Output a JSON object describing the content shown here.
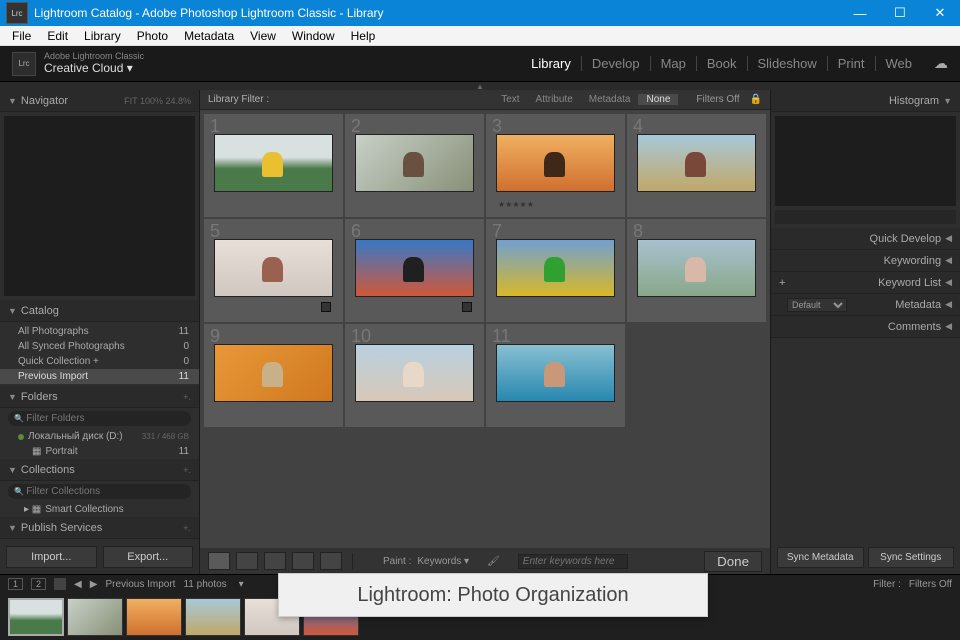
{
  "titlebar": {
    "icon": "Lrc",
    "title": "Lightroom Catalog - Adobe Photoshop Lightroom Classic - Library"
  },
  "menubar": [
    "File",
    "Edit",
    "Library",
    "Photo",
    "Metadata",
    "View",
    "Window",
    "Help"
  ],
  "idbar": {
    "line1": "Adobe Lightroom Classic",
    "line2": "Creative Cloud",
    "icon": "Lrc"
  },
  "modules": [
    {
      "label": "Library",
      "active": true
    },
    {
      "label": "Develop",
      "active": false
    },
    {
      "label": "Map",
      "active": false
    },
    {
      "label": "Book",
      "active": false
    },
    {
      "label": "Slideshow",
      "active": false
    },
    {
      "label": "Print",
      "active": false
    },
    {
      "label": "Web",
      "active": false
    }
  ],
  "nav": {
    "label": "Navigator",
    "zoom": "FIT   100%   24.8%"
  },
  "catalog": {
    "label": "Catalog",
    "items": [
      {
        "name": "All Photographs",
        "count": "11"
      },
      {
        "name": "All Synced Photographs",
        "count": "0"
      },
      {
        "name": "Quick Collection +",
        "count": "0"
      },
      {
        "name": "Previous Import",
        "count": "11",
        "selected": true
      }
    ]
  },
  "folders": {
    "label": "Folders",
    "filter": "Filter Folders",
    "items": [
      {
        "name": "Локальный диск (D:)",
        "size": "331 / 468 GB",
        "disk": true
      },
      {
        "name": "Portrait",
        "count": "11",
        "indent": true
      }
    ]
  },
  "collections": {
    "label": "Collections",
    "filter": "Filter Collections",
    "smart": "Smart Collections"
  },
  "publish": {
    "label": "Publish Services"
  },
  "import_btn": "Import...",
  "export_btn": "Export...",
  "filterbar": {
    "label": "Library Filter :",
    "tabs": [
      "Text",
      "Attribute",
      "Metadata",
      "None"
    ],
    "active": "None",
    "status": "Filters Off"
  },
  "thumbs": [
    {
      "n": "1",
      "g": "linear-gradient(180deg,#d8e0e0 40%,#4a7a4a 60%)",
      "accent": "#e8c030"
    },
    {
      "n": "2",
      "g": "linear-gradient(135deg,#c8d0c8,#889078)",
      "accent": "#6a5040"
    },
    {
      "n": "3",
      "g": "linear-gradient(180deg,#f0b060,#d07030)",
      "accent": "#402818",
      "stars": "★★★★★"
    },
    {
      "n": "4",
      "g": "linear-gradient(180deg,#a8c8d8,#c0a868)",
      "accent": "#7a4838"
    },
    {
      "n": "5",
      "g": "linear-gradient(180deg,#e8e0d8,#d0c8c0)",
      "accent": "#9a6050",
      "badge": true
    },
    {
      "n": "6",
      "g": "linear-gradient(180deg,#3878c8,#d05838)",
      "accent": "#202020",
      "badge": true
    },
    {
      "n": "7",
      "g": "linear-gradient(180deg,#70a0d0,#d8b828)",
      "accent": "#30a030"
    },
    {
      "n": "8",
      "g": "linear-gradient(180deg,#a8c0d0,#88a888)",
      "accent": "#d8b8a8"
    },
    {
      "n": "9",
      "g": "linear-gradient(135deg,#e89838,#d07820)",
      "accent": "#c8b088"
    },
    {
      "n": "10",
      "g": "linear-gradient(180deg,#b8d0e0,#d8c8b8)",
      "accent": "#e8d8c8"
    },
    {
      "n": "11",
      "g": "linear-gradient(180deg,#88c0d0,#2888b0)",
      "accent": "#c89878"
    }
  ],
  "toolbar": {
    "paint_label": "Paint :",
    "paint_mode": "Keywords",
    "kw_placeholder": "Enter keywords here",
    "done": "Done"
  },
  "right": {
    "histogram": "Histogram",
    "quickdev": "Quick Develop",
    "keywording": "Keywording",
    "keywordlist": "Keyword List",
    "metadata": "Metadata",
    "metadata_preset": "Default",
    "comments": "Comments",
    "sync_meta": "Sync Metadata",
    "sync_set": "Sync Settings"
  },
  "filmstrip": {
    "pages": [
      "1",
      "2"
    ],
    "path": "Previous Import",
    "count": "11 photos",
    "filter_label": "Filter :",
    "filter_value": "Filters Off"
  },
  "caption": "Lightroom: Photo Organization"
}
